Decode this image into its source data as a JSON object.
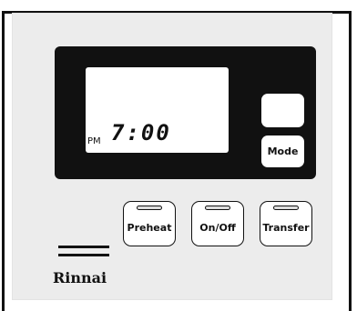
{
  "display": {
    "period": "PM",
    "time": "7:00"
  },
  "side_buttons": {
    "blank_label": "",
    "mode_label": "Mode"
  },
  "keys": [
    {
      "label": "Preheat"
    },
    {
      "label": "On/Off"
    },
    {
      "label": "Transfer"
    }
  ],
  "brand": {
    "name": "Rinnai"
  }
}
